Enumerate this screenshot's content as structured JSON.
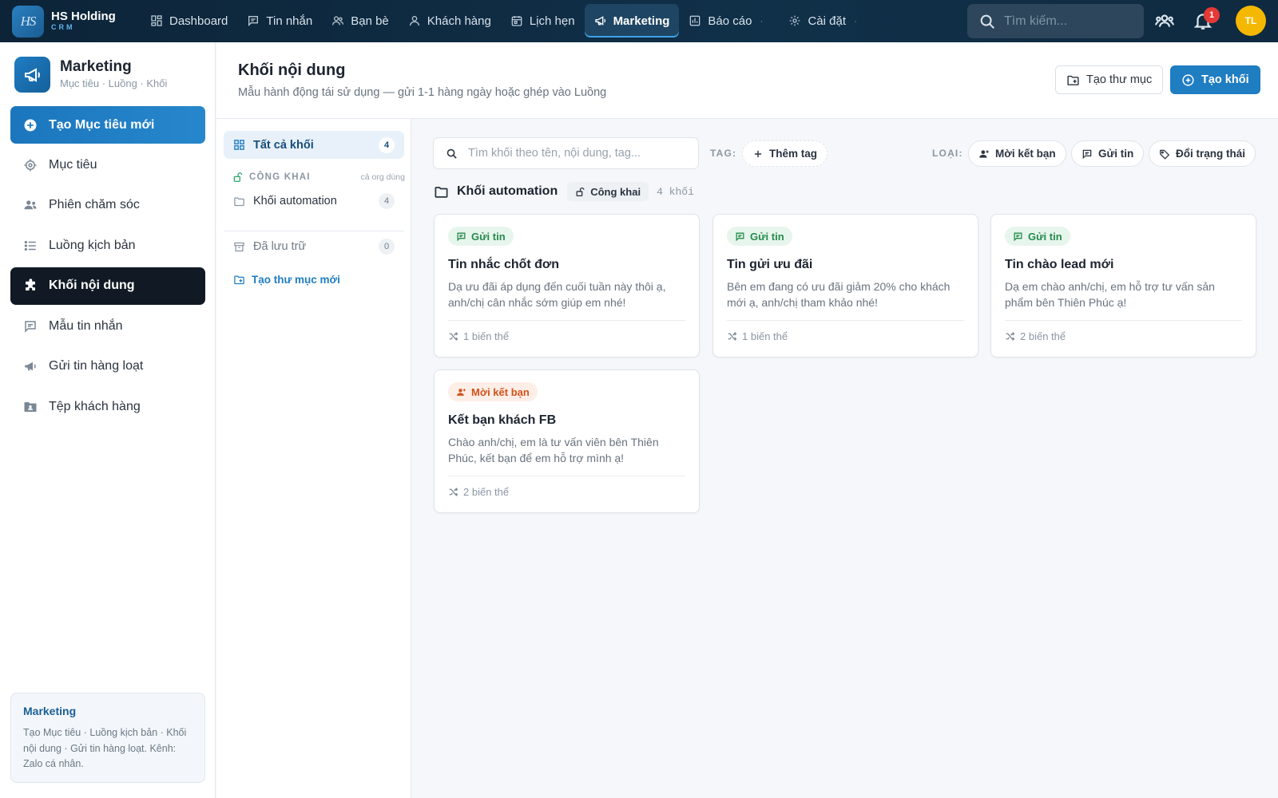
{
  "app": {
    "logo_text": "HS",
    "brand_name": "HS Holding",
    "brand_sub": "CRM"
  },
  "nav": [
    {
      "label": "Dashboard",
      "icon": "dashboard-icon"
    },
    {
      "label": "Tin nhắn",
      "icon": "message-icon"
    },
    {
      "label": "Bạn bè",
      "icon": "friends-icon"
    },
    {
      "label": "Khách hàng",
      "icon": "customer-icon"
    },
    {
      "label": "Lịch hẹn",
      "icon": "calendar-icon"
    },
    {
      "label": "Marketing",
      "icon": "megaphone-icon",
      "active": true
    },
    {
      "label": "Báo cáo",
      "icon": "report-icon"
    },
    {
      "label": "Cài đặt",
      "icon": "gear-icon"
    }
  ],
  "topbar": {
    "search_placeholder": "Tìm kiếm...",
    "notification_count": "1",
    "avatar_initials": "TL"
  },
  "sidebar": {
    "title": "Marketing",
    "subtitle": "Mục tiêu · Luồng · Khối",
    "cta_label": "Tạo Mục tiêu mới",
    "items": [
      {
        "label": "Mục tiêu",
        "icon": "target-icon"
      },
      {
        "label": "Phiên chăm sóc",
        "icon": "users-icon"
      },
      {
        "label": "Luồng kịch bản",
        "icon": "list-icon"
      },
      {
        "label": "Khối nội dung",
        "icon": "puzzle-icon",
        "active": true
      },
      {
        "label": "Mẫu tin nhắn",
        "icon": "message-icon"
      },
      {
        "label": "Gửi tin hàng loạt",
        "icon": "megaphone-icon"
      },
      {
        "label": "Tệp khách hàng",
        "icon": "folder-user-icon"
      }
    ],
    "info_title": "Marketing",
    "info_text": "Tạo Mục tiêu · Luồng kịch bản · Khối nội dung · Gửi tin hàng loạt. Kênh: Zalo cá nhân."
  },
  "header": {
    "title": "Khối nội dung",
    "subtitle": "Mẫu hành động tái sử dụng — gửi 1-1 hàng ngày hoặc ghép vào Luồng",
    "new_folder_label": "Tạo thư mục",
    "new_block_label": "Tạo khối"
  },
  "folders": {
    "all_label": "Tất cả khối",
    "all_count": "4",
    "section_label": "CÔNG KHAI",
    "section_note": "cả org dùng",
    "items": [
      {
        "label": "Khối automation",
        "count": "4"
      }
    ],
    "archive_label": "Đã lưu trữ",
    "archive_count": "0",
    "new_folder_label": "Tạo thư mục mới"
  },
  "filters": {
    "search_placeholder": "Tìm khối theo tên, nội dung, tag...",
    "tag_label": "TAG:",
    "add_tag_label": "Thêm tag",
    "type_label": "LOẠI:",
    "types": [
      "Mời kết bạn",
      "Gửi tin",
      "Đổi trạng thái"
    ]
  },
  "group": {
    "title": "Khối automation",
    "visibility": "Công khai",
    "count_text": "4 khối"
  },
  "cards": [
    {
      "tag": "Gửi tin",
      "tag_color": "green",
      "title": "Tin nhắc chốt đơn",
      "desc": "Dạ ưu đãi áp dụng đến cuối tuần này thôi ạ, anh/chị cân nhắc sớm giúp em nhé!",
      "variants": "1 biến thể"
    },
    {
      "tag": "Gửi tin",
      "tag_color": "green",
      "title": "Tin gửi ưu đãi",
      "desc": "Bên em đang có ưu đãi giảm 20% cho khách mới ạ, anh/chị tham khảo nhé!",
      "variants": "1 biến thể"
    },
    {
      "tag": "Gửi tin",
      "tag_color": "green",
      "title": "Tin chào lead mới",
      "desc": "Dạ em chào anh/chị, em hỗ trợ tư vấn sản phẩm bên Thiên Phúc ạ!",
      "variants": "2 biến thể"
    },
    {
      "tag": "Mời kết bạn",
      "tag_color": "orange",
      "title": "Kết bạn khách FB",
      "desc": "Chào anh/chị, em là tư vấn viên bên Thiên Phúc, kết bạn để em hỗ trợ mình ạ!",
      "variants": "2 biến thể"
    }
  ],
  "colors": {
    "topbar": "#0f2a40",
    "accent": "#1f7dc2",
    "active_sidebar": "#111a24",
    "tag_green": "#258a4d",
    "tag_orange": "#d0521c",
    "avatar": "#f5b800",
    "badge": "#e53935"
  }
}
